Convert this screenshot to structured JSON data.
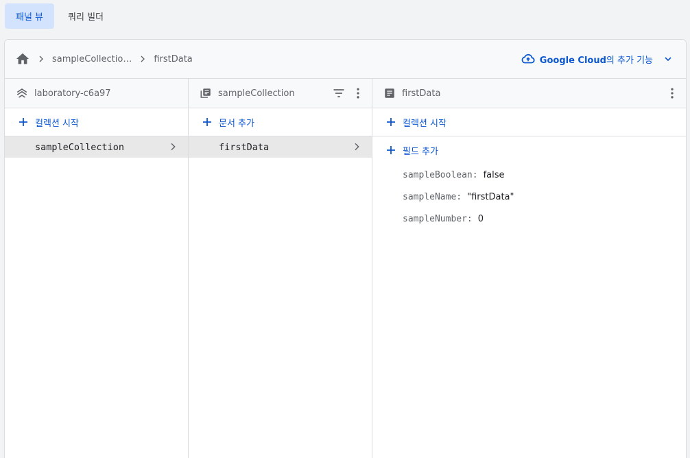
{
  "tabs": [
    {
      "label": "패널 뷰",
      "active": true
    },
    {
      "label": "쿼리 빌더",
      "active": false
    }
  ],
  "breadcrumb": {
    "items": [
      "sampleCollectio…",
      "firstData"
    ]
  },
  "gcloud": {
    "brand": "Google Cloud",
    "suffix": "의 추가 기능"
  },
  "columns": {
    "root": {
      "title": "laboratory-c6a97",
      "action": "컬렉션 시작",
      "items": [
        "sampleCollection"
      ]
    },
    "collection": {
      "title": "sampleCollection",
      "action": "문서 추가",
      "items": [
        "firstData"
      ]
    },
    "document": {
      "title": "firstData",
      "collection_action": "컬렉션 시작",
      "field_action": "필드 추가",
      "fields": [
        {
          "key": "sampleBoolean:",
          "value": "false"
        },
        {
          "key": "sampleName:",
          "value": "\"firstData\""
        },
        {
          "key": "sampleNumber:",
          "value": "0"
        }
      ]
    }
  },
  "colors": {
    "accent": "#0b57d0",
    "selected_row": "#e8e8e8",
    "icon": "#5f6368"
  }
}
